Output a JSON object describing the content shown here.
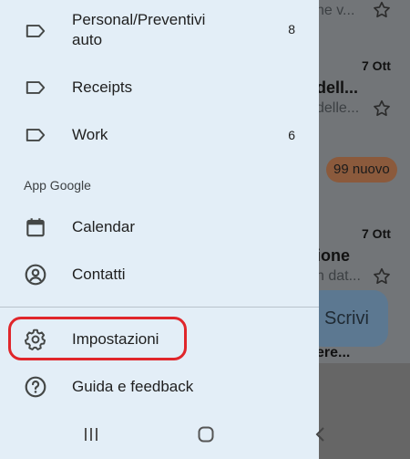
{
  "background": {
    "snippet_top": "he v...",
    "date_1": "7 Ott",
    "title_1": "dell...",
    "snippet_1": "delle...",
    "badge": "99 nuovo",
    "date_2": "7 Ott",
    "title_2": "ione",
    "snippet_2": "n dat...",
    "snippet_3": "ere...",
    "compose_label": "Scrivi"
  },
  "drawer": {
    "labels": [
      {
        "name": "Personal/Preventivi auto",
        "line1": "Personal/Preventivi",
        "line2": "auto",
        "count": "8"
      },
      {
        "name": "Receipts",
        "count": ""
      },
      {
        "name": "Work",
        "count": "6"
      }
    ],
    "section_title": "App Google",
    "apps": [
      {
        "label": "Calendar",
        "icon": "calendar-icon"
      },
      {
        "label": "Contatti",
        "icon": "contacts-icon"
      }
    ],
    "bottom": [
      {
        "label": "Impostazioni",
        "icon": "gear-icon"
      },
      {
        "label": "Guida e feedback",
        "icon": "help-icon"
      }
    ]
  },
  "nav": {
    "buttons": [
      "recent-apps-icon",
      "home-icon",
      "back-icon"
    ]
  },
  "colors": {
    "drawer_bg": "#e3eef7",
    "highlight": "#e0262b",
    "badge_bg": "#8b5a3c",
    "compose_bg": "#5c7891"
  }
}
